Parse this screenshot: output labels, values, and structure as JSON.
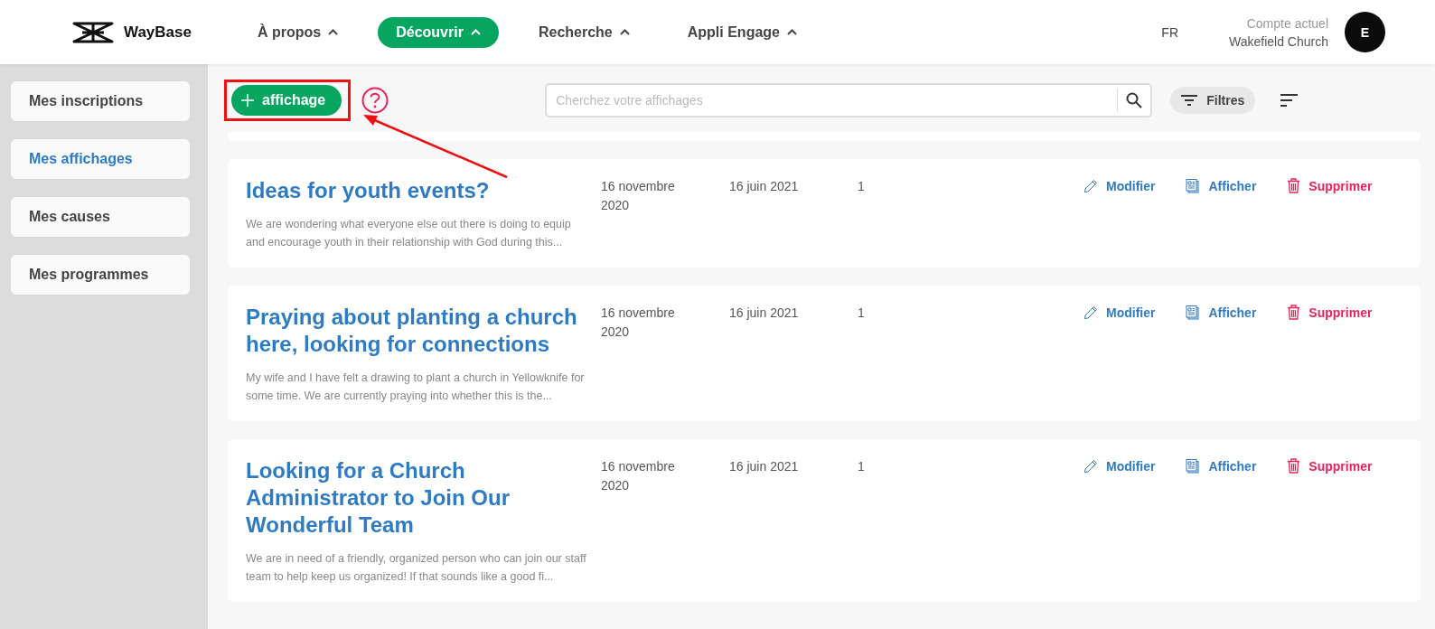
{
  "header": {
    "brand": "WayBase",
    "nav": [
      {
        "label": "À propos",
        "selected": false
      },
      {
        "label": "Découvrir",
        "selected": true
      },
      {
        "label": "Recherche",
        "selected": false
      },
      {
        "label": "Appli Engage",
        "selected": false
      }
    ],
    "language": "FR",
    "account_caption": "Compte actuel",
    "account_name": "Wakefield Church",
    "avatar": "E"
  },
  "sidebar": {
    "items": [
      {
        "label": "Mes inscriptions",
        "selected": false
      },
      {
        "label": "Mes affichages",
        "selected": true
      },
      {
        "label": "Mes causes",
        "selected": false
      },
      {
        "label": "Mes programmes",
        "selected": false
      }
    ]
  },
  "toolbar": {
    "add_button": "affichage",
    "search": {
      "placeholder": "Cherchez votre affichages"
    },
    "filters": "Filtres"
  },
  "postings": [
    {
      "title": "Ideas for youth events?",
      "excerpt": "We are wondering what everyone else out there is doing to equip and encourage youth in their relationship with God during this...",
      "created": "16 novembre 2020",
      "updated": "16 juin 2021",
      "count": "1",
      "actions": [
        "Modifier",
        "Afficher",
        "Supprimer"
      ]
    },
    {
      "title": "Praying about planting a church here, looking for connections",
      "excerpt": "My wife and I have felt a drawing to plant a church in Yellowknife for some time. We are currently praying into whether this is the...",
      "created": "16 novembre 2020",
      "updated": "16 juin 2021",
      "count": "1",
      "actions": [
        "Modifier",
        "Afficher",
        "Supprimer"
      ]
    },
    {
      "title": "Looking for a Church Administrator to Join Our Wonderful Team",
      "excerpt": "We are in need of a friendly, organized person who can join our staff team to help keep us organized! If that sounds like a good fi...",
      "created": "16 novembre 2020",
      "updated": "16 juin 2021",
      "count": "1",
      "actions": [
        "Modifier",
        "Afficher",
        "Supprimer"
      ]
    }
  ]
}
